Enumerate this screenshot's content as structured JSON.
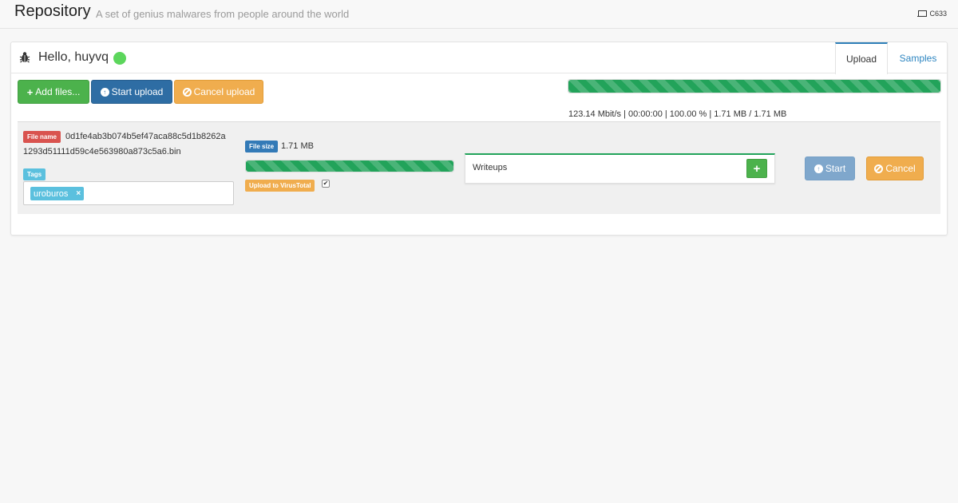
{
  "navbar": {
    "brand": "Repository",
    "tagline": "A set of genius malwares from people around the world",
    "host": "C633"
  },
  "header": {
    "greeting": "Hello, huyvq",
    "tabs": [
      {
        "label": "Upload",
        "active": true
      },
      {
        "label": "Samples",
        "active": false
      }
    ]
  },
  "toolbar": {
    "add_files_label": "Add files...",
    "start_upload_label": "Start upload",
    "cancel_upload_label": "Cancel upload"
  },
  "global_progress": {
    "percent": 100,
    "stats": "123.14 Mbit/s | 00:00:00 | 100.00 % | 1.71 MB / 1.71 MB"
  },
  "file": {
    "name_label": "File name",
    "name_line1": "0d1fe4ab3b074b5ef47aca88c5d1b8262a",
    "name_line2": "1293d51111d59c4e563980a873c5a6.bin",
    "tags_label": "Tags",
    "tags": [
      "uroburos"
    ],
    "tag_remove": "×",
    "size_label": "File size",
    "size_value": "1.71 MB",
    "progress_percent": 100,
    "vt_label": "Upload to VirusTotal",
    "vt_checked": true,
    "writeups_label": "Writeups",
    "writeups_add": "+",
    "start_label": "Start",
    "cancel_label": "Cancel"
  },
  "colors": {
    "success": "#22a35a",
    "primary": "#2e6da4",
    "warning": "#f0ad4e",
    "online": "#5cd65c"
  },
  "icons": [
    "laptop-icon",
    "bug-icon",
    "plus-icon",
    "upload-circle-icon",
    "ban-icon",
    "check-icon"
  ]
}
